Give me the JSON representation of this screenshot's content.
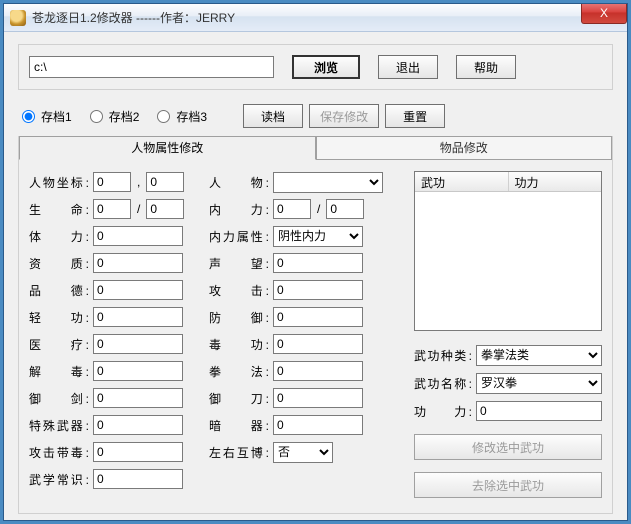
{
  "window": {
    "title": "苍龙逐日1.2修改器   ------作者：JERRY",
    "close_glyph": "X"
  },
  "path": {
    "value": "c:\\",
    "browse_label": "浏览",
    "exit_label": "退出",
    "help_label": "帮助"
  },
  "saves": {
    "slot1": "存档1",
    "slot2": "存档2",
    "slot3": "存档3",
    "load_label": "读档",
    "save_label": "保存修改",
    "reset_label": "重置"
  },
  "tabs": {
    "char_tab": "人物属性修改",
    "item_tab": "物品修改"
  },
  "left_fields": {
    "coord": "人物坐标",
    "life": "生　　命",
    "tili": "体　　力",
    "zizhi": "资　　质",
    "pinde": "品　　德",
    "qinggong": "轻　　功",
    "yiliao": "医　　疗",
    "jiedu": "解　　毒",
    "yujian": "御　　剑",
    "teshu": "特殊武器",
    "gjdd": "攻击带毒",
    "wxcs": "武学常识"
  },
  "mid_fields": {
    "renwu": "人　　物",
    "neili": "内　　力",
    "nlsx": "内力属性",
    "shengwang": "声　　望",
    "gongji": "攻　　击",
    "fangyu": "防　　御",
    "dugong": "毒　　功",
    "quanfa": "拳　　法",
    "yudao": "御　　刀",
    "anqi": "暗　　器",
    "zyhb": "左右互博"
  },
  "values": {
    "coord_x": "0",
    "coord_y": "0",
    "life_cur": "0",
    "life_max": "0",
    "tili": "0",
    "zizhi": "0",
    "pinde": "0",
    "qinggong": "0",
    "yiliao": "0",
    "jiedu": "0",
    "yujian": "0",
    "teshu": "0",
    "gjdd": "0",
    "wxcs": "0",
    "neili_cur": "0",
    "neili_max": "0",
    "shengwang": "0",
    "gongji": "0",
    "fangyu": "0",
    "dugong": "0",
    "quanfa": "0",
    "yudao": "0",
    "anqi": "0"
  },
  "selects": {
    "renwu_selected": "",
    "nlsx_selected": "阴性内力",
    "zyhb_selected": "否",
    "wgzl_selected": "拳掌法类",
    "wgmc_selected": "罗汉拳"
  },
  "right": {
    "list_col1": "武功",
    "list_col2": "功力",
    "wgzl": "武功种类",
    "wgmc": "武功名称",
    "gongli": "功　　力",
    "gongli_val": "0",
    "btn_modify": "修改选中武功",
    "btn_remove": "去除选中武功"
  }
}
